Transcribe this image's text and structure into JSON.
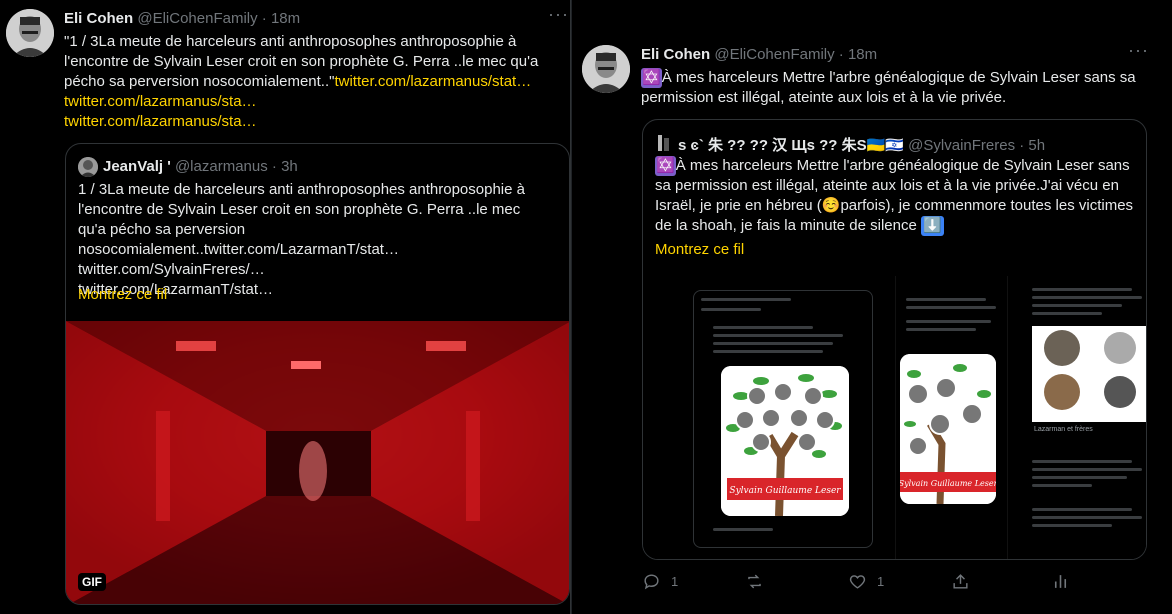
{
  "left_tweet": {
    "author_name": "Eli Cohen",
    "author_handle": "@EliCohenFamily",
    "dot": "·",
    "time": "18m",
    "text_main": "\"1 / 3La meute de harceleurs anti anthroposophes anthroposophie à l'encontre de Sylvain Leser croit en son prophète G. Perra ..le mec qu'a pécho sa perversion nosocomialement..\"",
    "text_link_inline": "twitter.com/lazarmanus/stat…",
    "link_2": "twitter.com/lazarmanus/sta…",
    "link_3": "twitter.com/lazarmanus/sta…",
    "quote": {
      "author_name": "JeanValj '",
      "author_handle": "@lazarmanus",
      "dot": "·",
      "time": "3h",
      "text": "1 / 3La meute de harceleurs anti anthroposophes anthroposophie à l'encontre de Sylvain Leser croit en son prophète G. Perra ..le mec qu'a pécho sa perversion nosocomialement..twitter.com/LazarmanT/stat…",
      "link_a": "twitter.com/SylvainFreres/…",
      "link_b": "twitter.com/LazarmanT/stat…",
      "show_thread": "Montrez ce fil",
      "gif_label": "GIF"
    }
  },
  "right_tweet": {
    "author_name": "Eli Cohen",
    "author_handle": "@EliCohenFamily",
    "dot": "·",
    "time": "18m",
    "star_emoji": "✡️",
    "text": "À mes harceleurs Mettre l'arbre généalogique de Sylvain Leser sans sa permission est illégal, ateinte aux lois et à la vie privée.",
    "quote": {
      "author_name": "s ͼ` 朱 ?? ?? 汉 Щs ?? 朱S🇺🇦🇮🇱",
      "author_handle": "@SylvainFreres",
      "dot": "·",
      "time": "5h",
      "star_emoji": "✡️",
      "text_1": "À mes harceleurs Mettre l'arbre généalogique de Sylvain Leser sans sa permission est illégal, ateinte aux lois et à la vie privée.J'ai vécu en Israël, je prie en hébreu (",
      "emoji_smile": "☺️",
      "text_2": "parfois), je commenmore toutes les victimes de la shoah, je fais la minute de silence",
      "arrow_emoji": "⬇️",
      "show_thread": "Montrez ce fil",
      "tree_banner": "Sylvain Guillaume Leser",
      "shot_caption": "Lazarman et frères"
    },
    "actions": {
      "reply_count": "1",
      "retweet_count": "",
      "like_count": "1"
    }
  },
  "colors": {
    "background": "#000000",
    "text": "#e7e9ea",
    "muted": "#71767b",
    "link": "#ffd400",
    "border": "#2f3336",
    "gif_red": "#c0151a"
  },
  "icons": [
    "more-icon",
    "reply-icon",
    "retweet-icon",
    "like-icon",
    "share-icon",
    "analytics-icon",
    "gif-badge"
  ]
}
